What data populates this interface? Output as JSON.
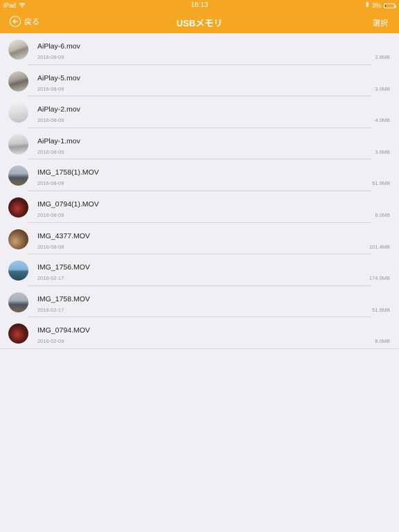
{
  "status_bar": {
    "device": "iPad",
    "time": "16:13",
    "battery_percent": "3%",
    "battery_level": 0.03
  },
  "nav": {
    "back_label": "戻る",
    "title": "USBメモリ",
    "select_label": "選択"
  },
  "files": [
    {
      "name": "AiPlay-6.mov",
      "date": "2016-08-09",
      "size": "2.8MB",
      "thumb": "t-paper"
    },
    {
      "name": "AiPlay-5.mov",
      "date": "2016-08-09",
      "size": "3.0MB",
      "thumb": "t-paper2"
    },
    {
      "name": "AiPlay-2.mov",
      "date": "2016-08-09",
      "size": "4.0MB",
      "thumb": "t-white"
    },
    {
      "name": "AiPlay-1.mov",
      "date": "2016-08-09",
      "size": "3.6MB",
      "thumb": "t-white2"
    },
    {
      "name": "IMG_1758(1).MOV",
      "date": "2016-08-09",
      "size": "51.9MB",
      "thumb": "t-city"
    },
    {
      "name": "IMG_0794(1).MOV",
      "date": "2016-08-09",
      "size": "8.0MB",
      "thumb": "t-red"
    },
    {
      "name": "IMG_4377.MOV",
      "date": "2016-08-08",
      "size": "101.4MB",
      "thumb": "t-brown"
    },
    {
      "name": "IMG_1756.MOV",
      "date": "2016-02-17",
      "size": "174.0MB",
      "thumb": "t-sea"
    },
    {
      "name": "IMG_1758.MOV",
      "date": "2016-02-17",
      "size": "51.9MB",
      "thumb": "t-city"
    },
    {
      "name": "IMG_0794.MOV",
      "date": "2016-02-09",
      "size": "8.0MB",
      "thumb": "t-red"
    }
  ]
}
